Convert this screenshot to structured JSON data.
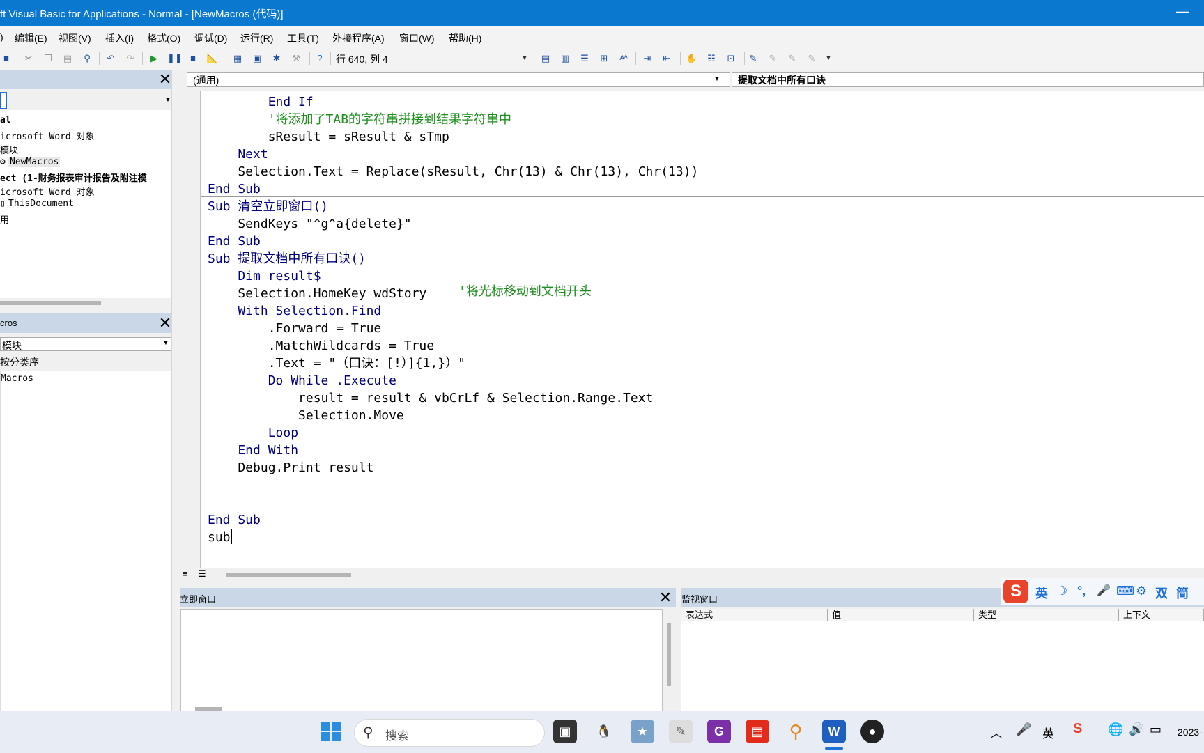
{
  "window": {
    "title": "ft Visual Basic for Applications - Normal - [NewMacros (代码)]",
    "minimize": "—"
  },
  "menu": [
    "编辑(E)",
    "视图(V)",
    "插入(I)",
    "格式(O)",
    "调试(D)",
    "运行(R)",
    "工具(T)",
    "外接程序(A)",
    "窗口(W)",
    "帮助(H)"
  ],
  "menu_first": ")",
  "toolbar": {
    "position": "行 640, 列 4"
  },
  "project": {
    "tree": [
      "al",
      "icrosoft Word 对象",
      "模块",
      "NewMacros",
      "ect (1-财务报表审计报告及附注模",
      "icrosoft Word 对象",
      "ThisDocument",
      "用"
    ]
  },
  "properties": {
    "title": "cros",
    "object_combo": "模块",
    "tab_label": "按分类序",
    "name_row": "Macros"
  },
  "code": {
    "object_combo": "(通用)",
    "proc_combo": "提取文档中所有口诀",
    "lines": [
      {
        "text": "        End If",
        "cls": ""
      },
      {
        "text": "        '将添加了TAB的字符串拼接到结果字符串中",
        "cls": "cmt"
      },
      {
        "text": "        sResult = sResult & sTmp",
        "cls": "txt"
      },
      {
        "text": "    Next",
        "cls": ""
      },
      {
        "text": "    Selection.Text = Replace(sResult, Chr(13) & Chr(13), Chr(13))",
        "cls": "txt"
      },
      {
        "text": "End Sub",
        "cls": ""
      },
      {
        "text": "Sub 清空立即窗口()",
        "cls": ""
      },
      {
        "text": "    SendKeys \"^g^a{delete}\"",
        "cls": "txt"
      },
      {
        "text": "End Sub",
        "cls": ""
      },
      {
        "text": "Sub 提取文档中所有口诀()",
        "cls": ""
      },
      {
        "text": "    Dim result$",
        "cls": ""
      },
      {
        "text": "    Selection.HomeKey wdStory ",
        "cls": "txt"
      },
      {
        "text": "    With Selection.Find",
        "cls": ""
      },
      {
        "text": "        .Forward = True",
        "cls": "txt"
      },
      {
        "text": "        .MatchWildcards = True",
        "cls": "txt"
      },
      {
        "text": "        .Text = \"（口诀：[!）]{1,}）\"",
        "cls": "txt"
      },
      {
        "text": "        Do While .Execute",
        "cls": ""
      },
      {
        "text": "            result = result & vbCrLf & Selection.Range.Text",
        "cls": "txt"
      },
      {
        "text": "            Selection.Move",
        "cls": "txt"
      },
      {
        "text": "        Loop",
        "cls": ""
      },
      {
        "text": "    End With",
        "cls": ""
      },
      {
        "text": "    Debug.Print result",
        "cls": "txt"
      },
      {
        "text": "",
        "cls": ""
      },
      {
        "text": "",
        "cls": ""
      },
      {
        "text": "End Sub",
        "cls": ""
      },
      {
        "text": "sub",
        "cls": "txt"
      }
    ],
    "homekey_comment": "'将光标移动到文档开头"
  },
  "immediate": {
    "title": "立即窗口"
  },
  "watch": {
    "title": "监视窗口",
    "columns": [
      "表达式",
      "值",
      "类型",
      "上下文"
    ]
  },
  "ime": {
    "items": [
      "英",
      "☽",
      "°,",
      "🎤",
      "⌨",
      "⚙",
      "双",
      "简"
    ]
  },
  "taskbar": {
    "search_placeholder": "搜索",
    "clock": "2023-"
  }
}
